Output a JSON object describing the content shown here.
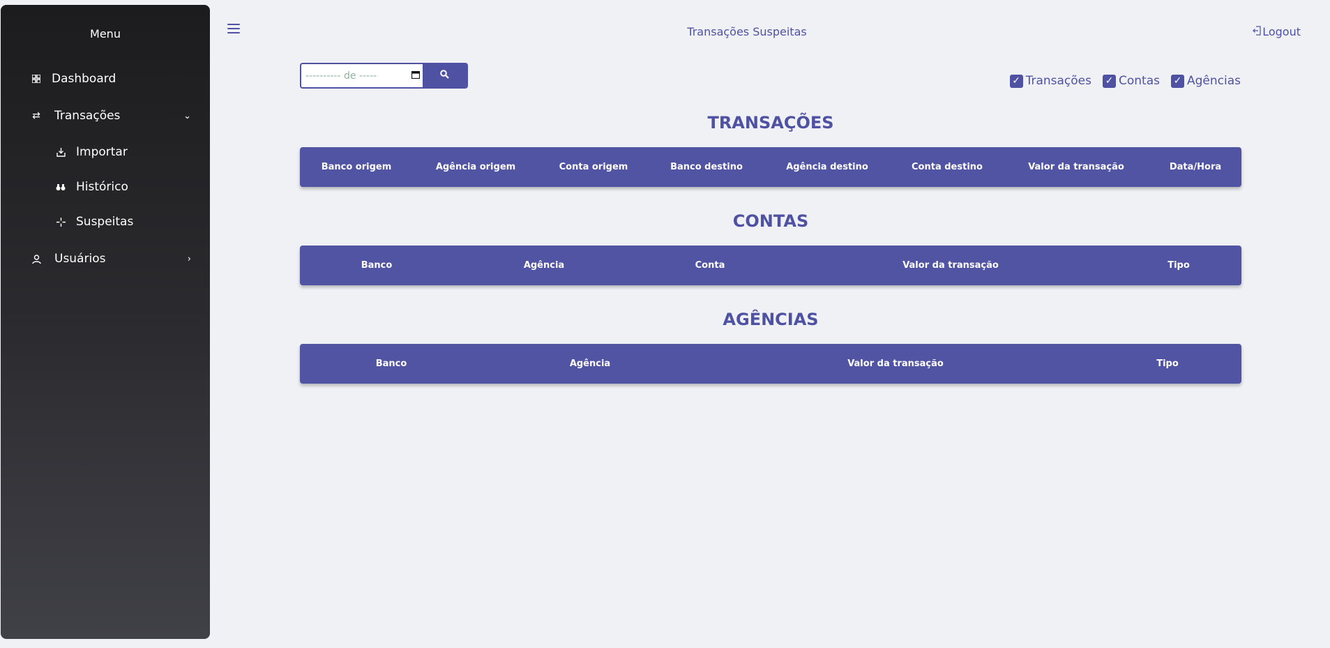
{
  "sidebar": {
    "title": "Menu",
    "items": [
      {
        "label": "Dashboard",
        "icon": "dashboard-grid-icon"
      },
      {
        "label": "Transações",
        "icon": "swap-arrows-icon"
      },
      {
        "label": "Importar",
        "icon": "import-tray-icon"
      },
      {
        "label": "Histórico",
        "icon": "binoculars-icon"
      },
      {
        "label": "Suspeitas",
        "icon": "crosshair-icon"
      },
      {
        "label": "Usuários",
        "icon": "user-icon"
      }
    ]
  },
  "header": {
    "title": "Transações Suspeitas",
    "logout_label": "Logout"
  },
  "search": {
    "date_placeholder": "---------- de -----"
  },
  "filters": [
    {
      "label": "Transações",
      "checked": true
    },
    {
      "label": "Contas",
      "checked": true
    },
    {
      "label": "Agências",
      "checked": true
    }
  ],
  "sections": {
    "transacoes": {
      "title": "TRANSAÇÕES",
      "columns": [
        "Banco origem",
        "Agência origem",
        "Conta origem",
        "Banco destino",
        "Agência destino",
        "Conta destino",
        "Valor da transação",
        "Data/Hora"
      ]
    },
    "contas": {
      "title": "CONTAS",
      "columns": [
        "Banco",
        "Agência",
        "Conta",
        "Valor da transação",
        "Tipo"
      ]
    },
    "agencias": {
      "title": "AGÊNCIAS",
      "columns": [
        "Banco",
        "Agência",
        "Valor da transação",
        "Tipo"
      ]
    }
  },
  "colors": {
    "accent": "#4f52a2",
    "table_header": "#5153a3",
    "background": "#f0f1f5"
  }
}
